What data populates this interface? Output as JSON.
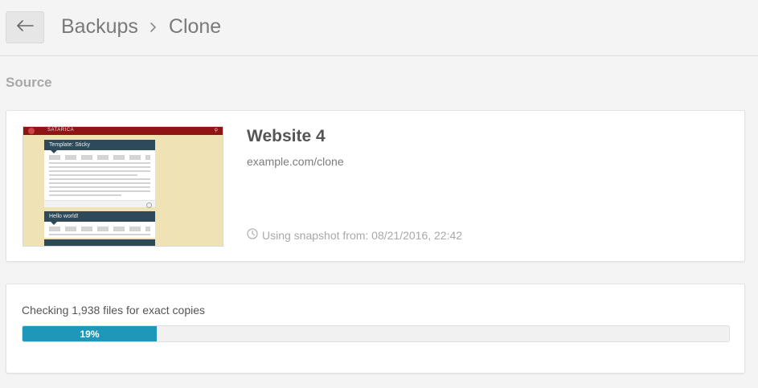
{
  "header": {
    "back_icon": "arrow-left-icon",
    "breadcrumb": {
      "parent": "Backups",
      "separator_icon": "chevron-right-icon",
      "current": "Clone"
    }
  },
  "source": {
    "section_title": "Source",
    "site_name": "Website 4",
    "site_url": "example.com/clone",
    "snapshot_icon": "clock-icon",
    "snapshot_text": "Using snapshot from: 08/21/2016, 22:42",
    "thumbnail": {
      "brand": "SATARICA",
      "post1_title": "Template: Sticky",
      "post2_title": "Hello world!"
    }
  },
  "progress": {
    "label": "Checking 1,938 files for exact copies",
    "percent_text": "19%",
    "fraction": 0.19,
    "color": "#1e97b8"
  }
}
